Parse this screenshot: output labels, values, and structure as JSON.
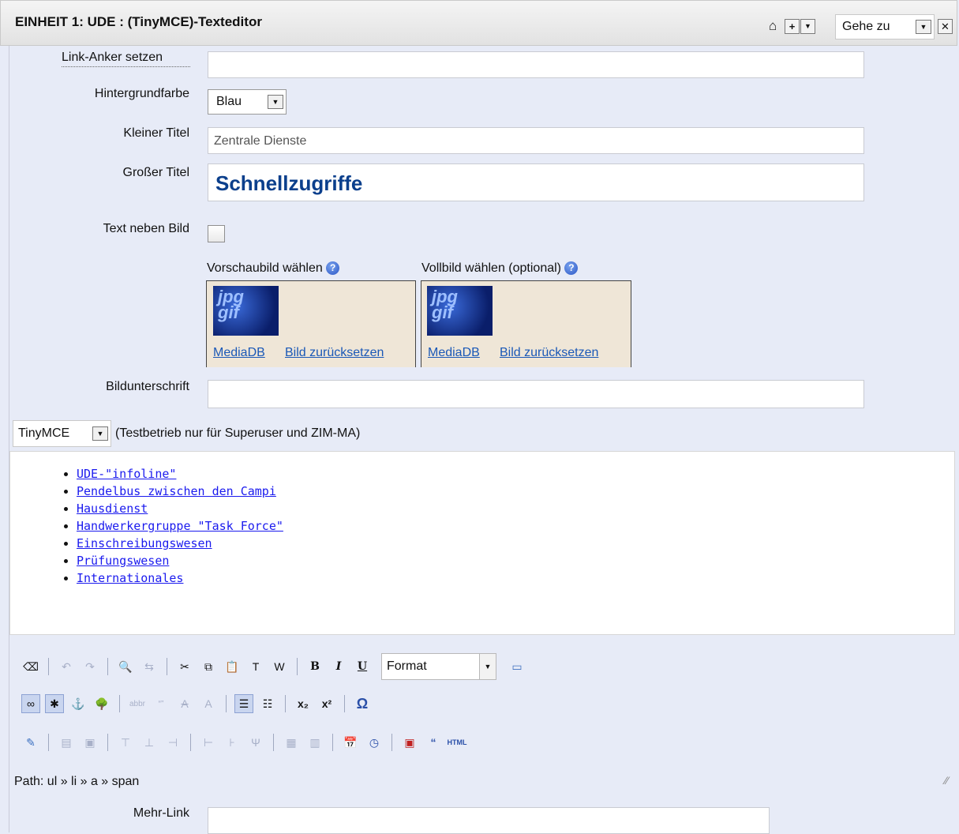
{
  "header": {
    "title": "EINHEIT 1: UDE : (TinyMCE)-Texteditor",
    "goto_label": "Gehe zu",
    "icons": [
      "home-icon",
      "plus-box-icon",
      "dropdown-arrow-icon",
      "close-icon"
    ]
  },
  "form": {
    "link_anchor": {
      "label": "Link-Anker setzen",
      "value": ""
    },
    "background": {
      "label": "Hintergrundfarbe",
      "value": "Blau"
    },
    "small_title": {
      "label": "Kleiner Titel",
      "value": "Zentrale Dienste"
    },
    "big_title": {
      "label": "Großer Titel",
      "value": "Schnellzugriffe"
    },
    "text_beside_image": {
      "label": "Text neben Bild",
      "checked": false
    },
    "preview_image": {
      "label": "Vorschaubild wählen",
      "link_mediadb": "MediaDB",
      "link_reset": "Bild zurücksetzen"
    },
    "full_image": {
      "label": "Vollbild wählen (optional)",
      "link_mediadb": "MediaDB",
      "link_reset": "Bild zurücksetzen"
    },
    "caption": {
      "label": "Bildunterschrift",
      "value": ""
    }
  },
  "editor": {
    "mode_select": "TinyMCE",
    "mode_note": "(Testbetrieb nur für Superuser und ZIM-MA)",
    "items": [
      "UDE-\"infoline\"",
      "Pendelbus zwischen den Campi",
      "Hausdienst",
      "Handwerkergruppe \"Task Force\"",
      "Einschreibungswesen",
      "Prüfungswesen",
      "Internationales"
    ],
    "format_select": "Format",
    "path": "Path: ul » li » a » span"
  },
  "more_link": {
    "label": "Mehr-Link",
    "value": ""
  },
  "colors": {
    "link": "#1a58b7",
    "big_title": "#0b3f8c",
    "background": "#e7ebf7"
  }
}
